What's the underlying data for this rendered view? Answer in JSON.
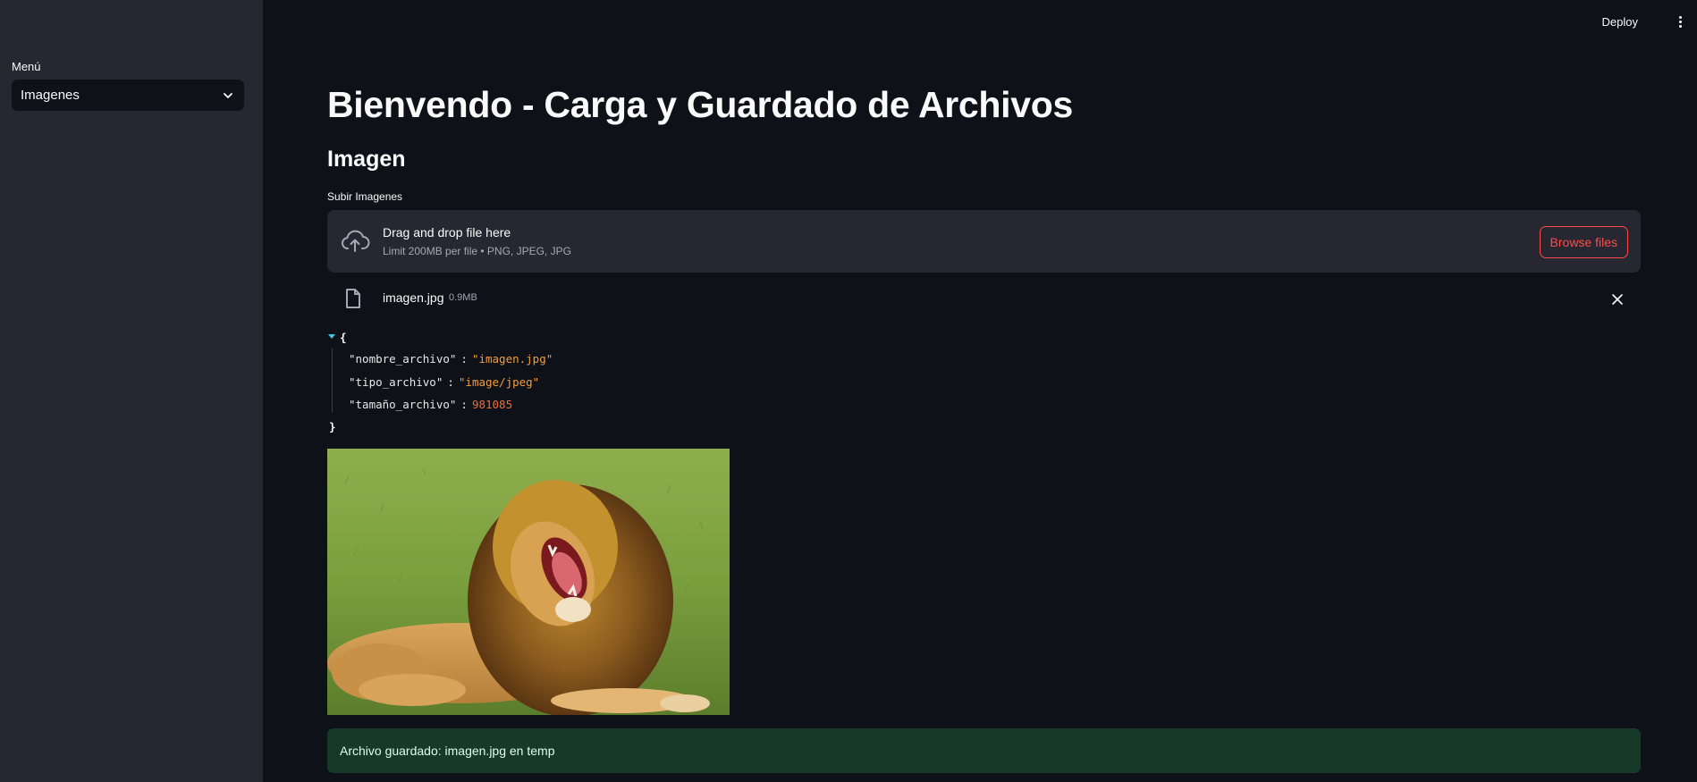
{
  "sidebar": {
    "menu_label": "Menú",
    "select_value": "Imagenes"
  },
  "header": {
    "deploy_label": "Deploy"
  },
  "main": {
    "title": "Bienvendo - Carga y Guardado de Archivos",
    "subheader": "Imagen",
    "uploader": {
      "label": "Subir Imagenes",
      "drop_title": "Drag and drop file here",
      "drop_limit": "Limit 200MB per file • PNG, JPEG, JPG",
      "browse_label": "Browse files"
    },
    "uploaded_file": {
      "name": "imagen.jpg",
      "size": "0.9MB"
    },
    "json_view": {
      "open_brace": "{",
      "close_brace": "}",
      "entries": [
        {
          "key": "\"nombre_archivo\"",
          "colon": ":",
          "value": "\"imagen.jpg\""
        },
        {
          "key": "\"tipo_archivo\"",
          "colon": ":",
          "value": "\"image/jpeg\""
        },
        {
          "key": "\"tamaño_archivo\"",
          "colon": ":",
          "value": "981085"
        }
      ]
    },
    "success_message": "Archivo guardado: imagen.jpg en temp"
  },
  "colors": {
    "background": "#0e1117",
    "sidebar": "#262730",
    "accent": "#ff4b4b",
    "success_bg": "#173928",
    "json_string": "#f39c3b",
    "json_number": "#ee6d3b"
  },
  "icons": [
    "chevron-down-icon",
    "cloud-upload-icon",
    "file-icon",
    "close-icon",
    "more-vertical-icon",
    "caret-down-icon"
  ]
}
